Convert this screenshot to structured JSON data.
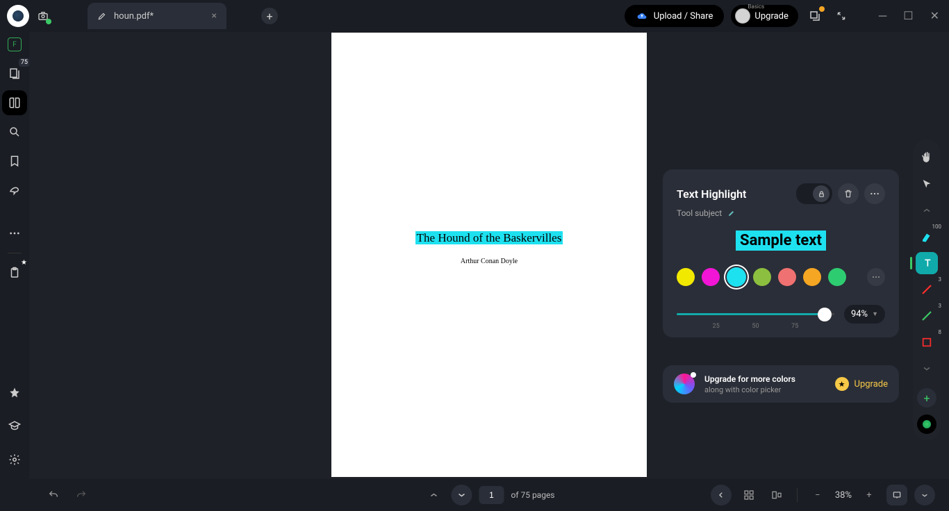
{
  "tab": {
    "filename": "houn.pdf*"
  },
  "titlebar": {
    "upload_label": "Upload / Share",
    "upgrade_label": "Upgrade",
    "basics_label": "Basics"
  },
  "left_sidebar": {
    "page_badge": "75"
  },
  "document": {
    "title": "The Hound of the Baskervilles",
    "author": "Arthur Conan Doyle"
  },
  "tool_panel": {
    "title": "Text Highlight",
    "subject": "Tool subject",
    "sample": "Sample text",
    "colors": [
      {
        "hex": "#f2e900"
      },
      {
        "hex": "#f215d6"
      },
      {
        "hex": "#1ee1f0"
      },
      {
        "hex": "#8cbf3f"
      },
      {
        "hex": "#f07171"
      },
      {
        "hex": "#f5a623"
      },
      {
        "hex": "#2ecc71"
      }
    ],
    "selected_color_index": 2,
    "opacity": 94,
    "opacity_label": "94%",
    "ticks": [
      "25",
      "50",
      "75"
    ]
  },
  "upgrade_panel": {
    "title": "Upgrade for more colors",
    "subtitle": "along with color picker",
    "cta": "Upgrade"
  },
  "right_toolbar": {
    "highlight_badge": "100",
    "red_badge": "3",
    "green_badge": "3",
    "box_badge": "8"
  },
  "bottombar": {
    "page_input": "1",
    "page_total": "of 75 pages",
    "zoom": "38%"
  }
}
